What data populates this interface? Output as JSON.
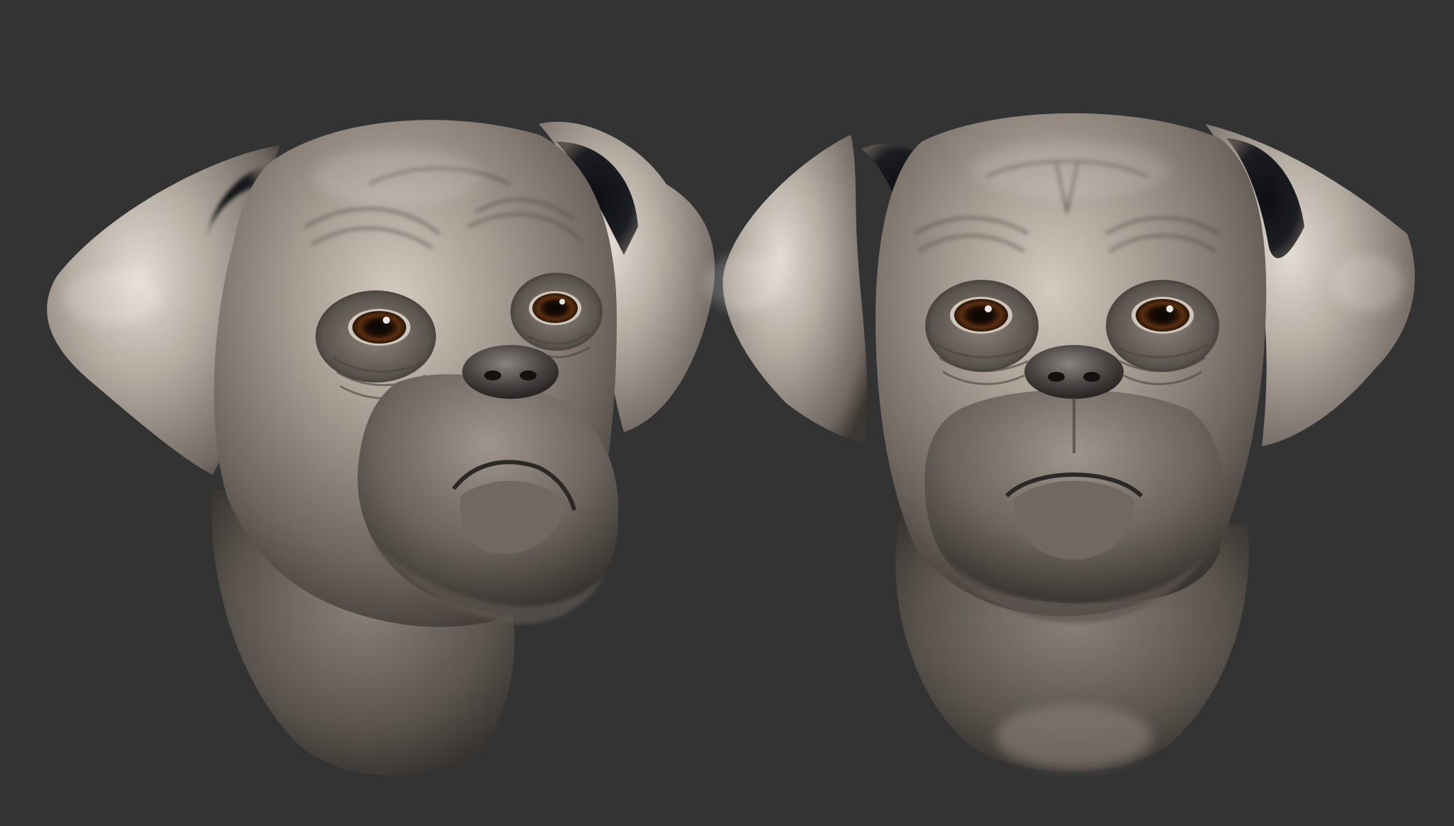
{
  "scene": {
    "background_color": "#333333",
    "clay_color": "#8c837b",
    "clay_highlight_color": "#d8d0c6",
    "clay_shadow_color": "#2e2a27",
    "eye_iris_color": "#3a1e0a",
    "eye_pupil_color": "#0a0604",
    "subjects": [
      {
        "view": "three-quarter"
      },
      {
        "view": "front"
      }
    ]
  }
}
